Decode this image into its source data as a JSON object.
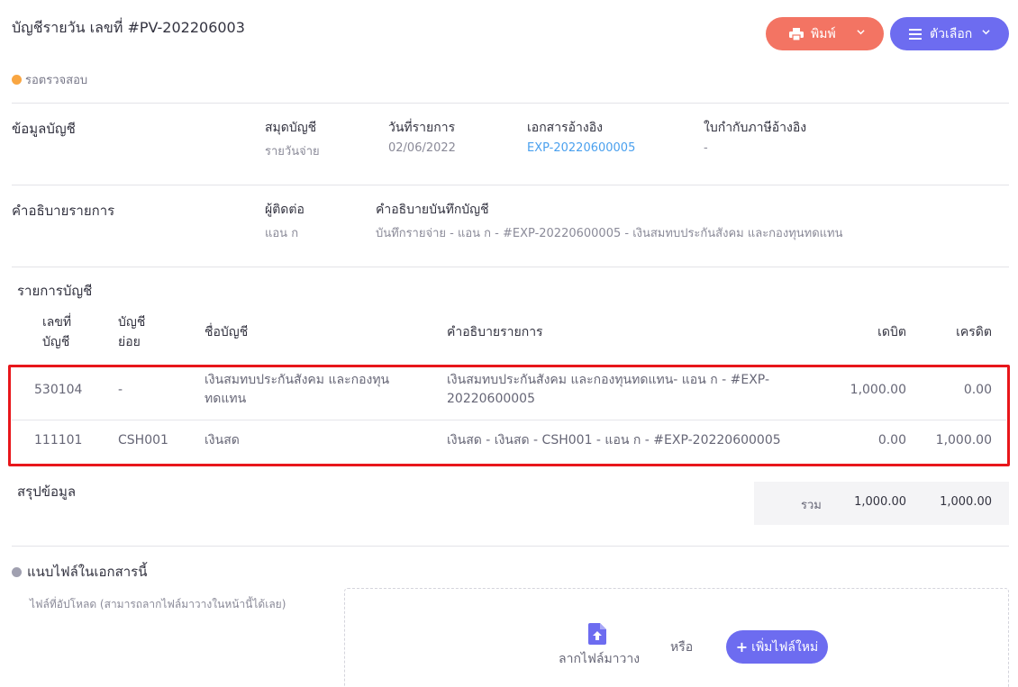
{
  "header": {
    "title": "บัญชีรายวัน เลขที่ #PV-202206003",
    "print_label": "พิมพ์",
    "options_label": "ตัวเลือก",
    "status": "รอตรวจสอบ"
  },
  "account_info": {
    "section_label": "ข้อมูลบัญชี",
    "journal_label": "สมุดบัญชี",
    "journal_value": "รายวันจ่าย",
    "date_label": "วันที่รายการ",
    "date_value": "02/06/2022",
    "ref_doc_label": "เอกสารอ้างอิง",
    "ref_doc_value": "EXP-20220600005",
    "tax_invoice_label": "ใบกำกับภาษีอ้างอิง",
    "tax_invoice_value": "-"
  },
  "description": {
    "section_label": "คำอธิบายรายการ",
    "contact_label": "ผู้ติดต่อ",
    "contact_value": "แอน ก",
    "memo_label": "คำอธิบายบันทึกบัญชี",
    "memo_value": "บันทึกรายจ่าย - แอน ก - #EXP-20220600005 - เงินสมทบประกันสังคม และกองทุนทดแทน"
  },
  "entries": {
    "section_label": "รายการบัญชี",
    "columns": {
      "account_no_1": "เลขที่",
      "account_no_2": "บัญชี",
      "sub_account_1": "บัญชี",
      "sub_account_2": "ย่อย",
      "account_name": "ชื่อบัญชี",
      "description": "คำอธิบายรายการ",
      "debit": "เดบิต",
      "credit": "เครดิต"
    },
    "rows": [
      {
        "account_no": "530104",
        "sub_account": "-",
        "account_name_1": "เงินสมทบประกันสังคม และกองทุน",
        "account_name_2": "ทดแทน",
        "description_1": "เงินสมทบประกันสังคม และกองทุนทดแทน- แอน ก - #EXP-",
        "description_2": "20220600005",
        "debit": "1,000.00",
        "credit": "0.00"
      },
      {
        "account_no": "111101",
        "sub_account": "CSH001",
        "account_name_1": "เงินสด",
        "description_1": "เงินสด - เงินสด - CSH001 - แอน ก - #EXP-20220600005",
        "debit": "0.00",
        "credit": "1,000.00"
      }
    ]
  },
  "summary": {
    "section_label": "สรุปข้อมูล",
    "total_label": "รวม",
    "total_debit": "1,000.00",
    "total_credit": "1,000.00"
  },
  "attachments": {
    "title": "แนบไฟล์ในเอกสารนี้",
    "note": "ไฟล์ที่อัปโหลด (สามารถลากไฟล์มาวางในหน้านี้ได้เลย)",
    "drag_label": "ลากไฟล์มาวาง",
    "or_label": "หรือ",
    "add_label": "เพิ่มไฟล์ใหม่"
  },
  "colors": {
    "print_button": "#f37463",
    "primary": "#6d6cf0",
    "status_dot": "#f9a642",
    "link": "#4aa0ee",
    "highlight": "#e8161b"
  },
  "icons": [
    "printer-icon",
    "menu-icon",
    "chevron-down-icon",
    "file-upload-icon",
    "plus-icon"
  ]
}
